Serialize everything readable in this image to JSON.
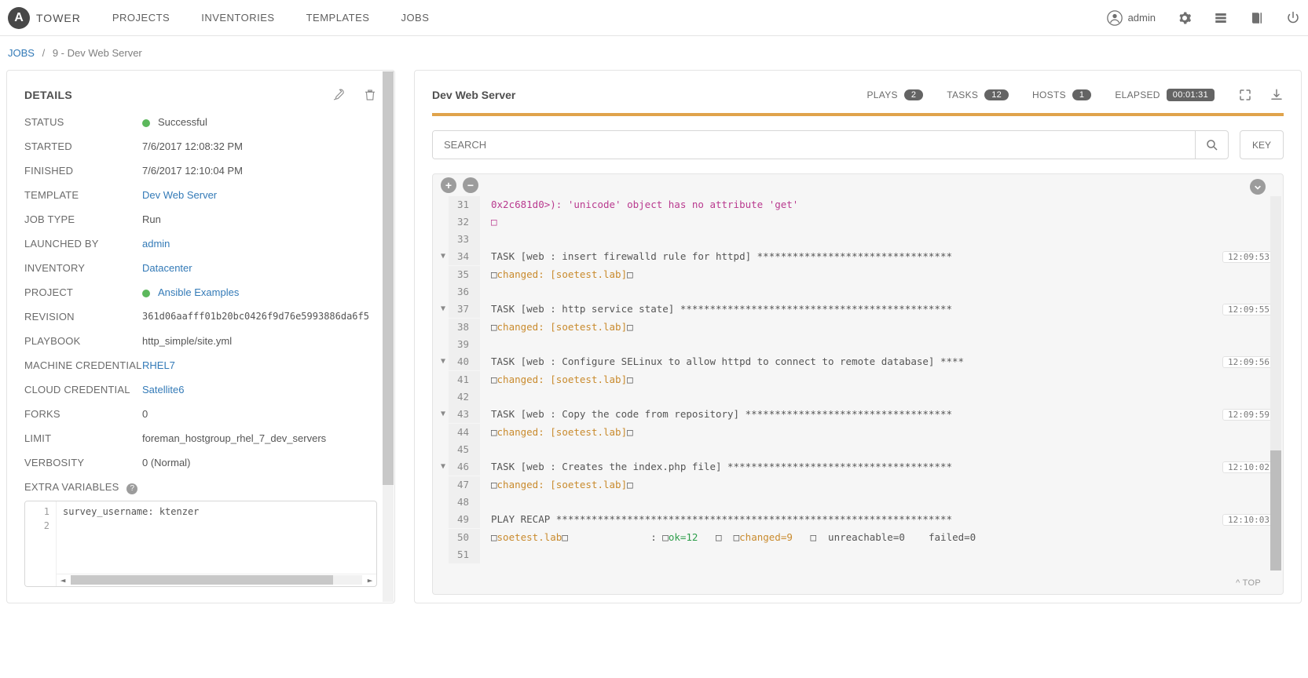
{
  "brand": {
    "name": "TOWER",
    "initial": "A"
  },
  "nav": {
    "projects": "PROJECTS",
    "inventories": "INVENTORIES",
    "templates": "TEMPLATES",
    "jobs": "JOBS"
  },
  "user": {
    "name": "admin"
  },
  "breadcrumb": {
    "jobs": "JOBS",
    "sep": "/",
    "current": "9 - Dev Web Server"
  },
  "details": {
    "title": "DETAILS",
    "labels": {
      "status": "STATUS",
      "started": "STARTED",
      "finished": "FINISHED",
      "template": "TEMPLATE",
      "job_type": "JOB TYPE",
      "launched_by": "LAUNCHED BY",
      "inventory": "INVENTORY",
      "project": "PROJECT",
      "revision": "REVISION",
      "playbook": "PLAYBOOK",
      "machine_cred": "MACHINE CREDENTIAL",
      "cloud_cred": "CLOUD CREDENTIAL",
      "forks": "FORKS",
      "limit": "LIMIT",
      "verbosity": "VERBOSITY",
      "extra_vars": "EXTRA VARIABLES"
    },
    "values": {
      "status": "Successful",
      "started": "7/6/2017 12:08:32 PM",
      "finished": "7/6/2017 12:10:04 PM",
      "template": "Dev Web Server",
      "job_type": "Run",
      "launched_by": "admin",
      "inventory": "Datacenter",
      "project": "Ansible Examples",
      "revision": "361d06aafff01b20bc0426f9d76e5993886da6f5",
      "playbook": "http_simple/site.yml",
      "machine_cred": "RHEL7",
      "cloud_cred": "Satellite6",
      "forks": "0",
      "limit": "foreman_hostgroup_rhel_7_dev_servers",
      "verbosity": "0 (Normal)"
    },
    "extra_vars": {
      "gutter": [
        "1",
        "2"
      ],
      "code": "survey_username: ktenzer"
    }
  },
  "output": {
    "title": "Dev Web Server",
    "stats": {
      "plays_label": "PLAYS",
      "plays": "2",
      "tasks_label": "TASKS",
      "tasks": "12",
      "hosts_label": "HOSTS",
      "hosts": "1",
      "elapsed_label": "ELAPSED",
      "elapsed": "00:01:31"
    },
    "search_placeholder": "SEARCH",
    "key_label": "KEY",
    "top_label": "^ TOP",
    "lines": [
      {
        "n": "31",
        "chev": "",
        "ts": "",
        "segments": [
          {
            "t": "0x2c681d0>): 'unicode' object has no attribute 'get'",
            "c": "c-magenta"
          }
        ]
      },
      {
        "n": "32",
        "chev": "",
        "ts": "",
        "segments": [
          {
            "t": "□",
            "c": "c-magenta"
          }
        ]
      },
      {
        "n": "33",
        "chev": "",
        "ts": "",
        "segments": [
          {
            "t": " "
          }
        ]
      },
      {
        "n": "34",
        "chev": "▼",
        "ts": "12:09:53",
        "segments": [
          {
            "t": "TASK [web : insert firewalld rule for httpd] *********************************"
          }
        ]
      },
      {
        "n": "35",
        "chev": "",
        "ts": "",
        "segments": [
          {
            "t": "□",
            "c": "sq"
          },
          {
            "t": "changed: ",
            "c": "c-orange"
          },
          {
            "t": "[soetest.lab]",
            "c": "c-orange"
          },
          {
            "t": "□",
            "c": "sq"
          }
        ]
      },
      {
        "n": "36",
        "chev": "",
        "ts": "",
        "segments": [
          {
            "t": " "
          }
        ]
      },
      {
        "n": "37",
        "chev": "▼",
        "ts": "12:09:55",
        "segments": [
          {
            "t": "TASK [web : http service state] **********************************************"
          }
        ]
      },
      {
        "n": "38",
        "chev": "",
        "ts": "",
        "segments": [
          {
            "t": "□",
            "c": "sq"
          },
          {
            "t": "changed: ",
            "c": "c-orange"
          },
          {
            "t": "[soetest.lab]",
            "c": "c-orange"
          },
          {
            "t": "□",
            "c": "sq"
          }
        ]
      },
      {
        "n": "39",
        "chev": "",
        "ts": "",
        "segments": [
          {
            "t": " "
          }
        ]
      },
      {
        "n": "40",
        "chev": "▼",
        "ts": "12:09:56",
        "segments": [
          {
            "t": "TASK [web : Configure SELinux to allow httpd to connect to remote database] ****"
          }
        ]
      },
      {
        "n": "41",
        "chev": "",
        "ts": "",
        "segments": [
          {
            "t": "□",
            "c": "sq"
          },
          {
            "t": "changed: ",
            "c": "c-orange"
          },
          {
            "t": "[soetest.lab]",
            "c": "c-orange"
          },
          {
            "t": "□",
            "c": "sq"
          }
        ]
      },
      {
        "n": "42",
        "chev": "",
        "ts": "",
        "segments": [
          {
            "t": " "
          }
        ]
      },
      {
        "n": "43",
        "chev": "▼",
        "ts": "12:09:59",
        "segments": [
          {
            "t": "TASK [web : Copy the code from repository] ***********************************"
          }
        ]
      },
      {
        "n": "44",
        "chev": "",
        "ts": "",
        "segments": [
          {
            "t": "□",
            "c": "sq"
          },
          {
            "t": "changed: ",
            "c": "c-orange"
          },
          {
            "t": "[soetest.lab]",
            "c": "c-orange"
          },
          {
            "t": "□",
            "c": "sq"
          }
        ]
      },
      {
        "n": "45",
        "chev": "",
        "ts": "",
        "segments": [
          {
            "t": " "
          }
        ]
      },
      {
        "n": "46",
        "chev": "▼",
        "ts": "12:10:02",
        "segments": [
          {
            "t": "TASK [web : Creates the index.php file] **************************************"
          }
        ]
      },
      {
        "n": "47",
        "chev": "",
        "ts": "",
        "segments": [
          {
            "t": "□",
            "c": "sq"
          },
          {
            "t": "changed: ",
            "c": "c-orange"
          },
          {
            "t": "[soetest.lab]",
            "c": "c-orange"
          },
          {
            "t": "□",
            "c": "sq"
          }
        ]
      },
      {
        "n": "48",
        "chev": "",
        "ts": "",
        "segments": [
          {
            "t": " "
          }
        ]
      },
      {
        "n": "49",
        "chev": "",
        "ts": "12:10:03",
        "segments": [
          {
            "t": "PLAY RECAP *******************************************************************"
          }
        ]
      },
      {
        "n": "50",
        "chev": "",
        "ts": "",
        "segments": [
          {
            "t": "□",
            "c": "sq"
          },
          {
            "t": "soetest.lab",
            "c": "c-orange"
          },
          {
            "t": "□",
            "c": "sq"
          },
          {
            "t": "              : "
          },
          {
            "t": "□",
            "c": "sq"
          },
          {
            "t": "ok=12",
            "c": "c-green"
          },
          {
            "t": "   "
          },
          {
            "t": "□",
            "c": "sq"
          },
          {
            "t": "  "
          },
          {
            "t": "□",
            "c": "sq"
          },
          {
            "t": "changed=9",
            "c": "c-orange"
          },
          {
            "t": "   "
          },
          {
            "t": "□",
            "c": "sq"
          },
          {
            "t": "  unreachable=0    failed=0"
          }
        ]
      },
      {
        "n": "51",
        "chev": "",
        "ts": "",
        "segments": [
          {
            "t": " "
          }
        ]
      }
    ]
  }
}
